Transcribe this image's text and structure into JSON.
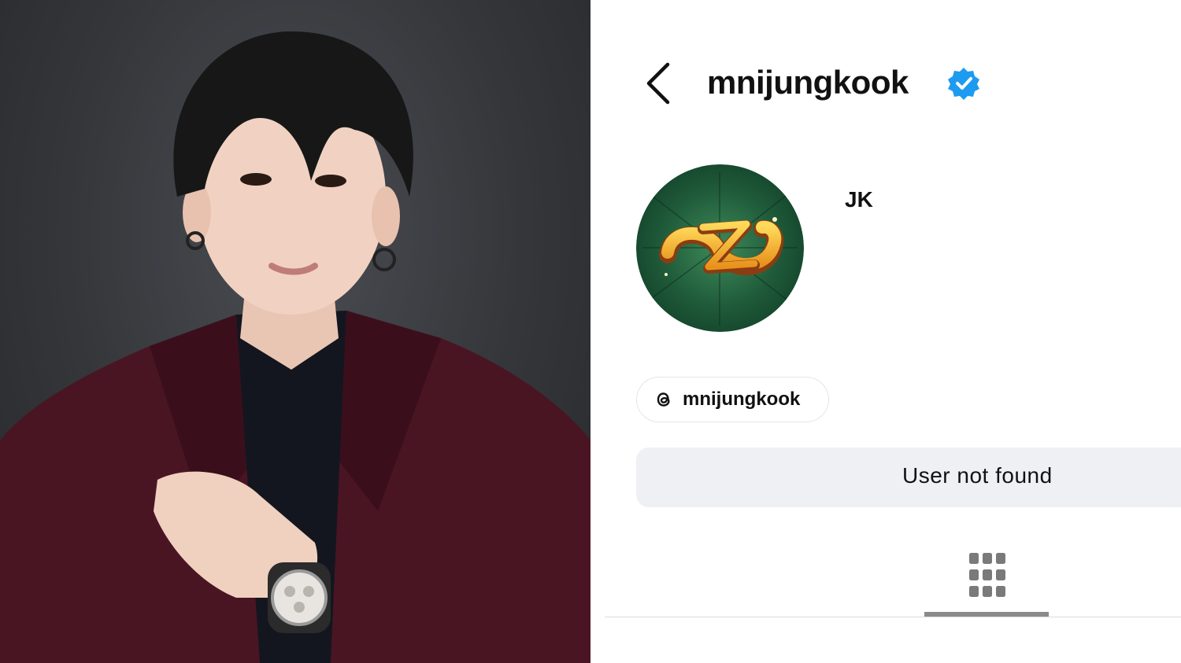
{
  "header": {
    "username": "mnijungkook",
    "verified": true,
    "back_icon": "chevron-left-icon",
    "verified_icon": "verified-badge-icon"
  },
  "profile": {
    "display_name": "JK",
    "avatar": "avatar-gold-swirl-logo-green-circle",
    "threads_link": {
      "icon": "threads-icon",
      "label": "mnijungkook"
    },
    "status_message": "User not found"
  },
  "tabs": {
    "active": "grid",
    "grid_icon": "grid-icon"
  },
  "colors": {
    "verified_blue": "#1d9bf0",
    "avatar_green": "#1f5b3a",
    "logo_gold": "#f2b631",
    "status_bg": "#eef0f3",
    "tab_indicator": "#8a8a8a",
    "photo_backdrop": "#34363a",
    "suit_burgundy": "#4a1523"
  }
}
